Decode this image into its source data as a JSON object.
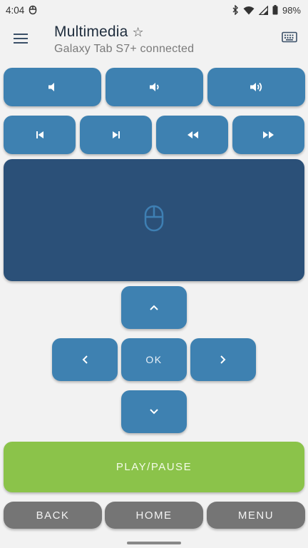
{
  "status_bar": {
    "time": "4:04",
    "battery": "98%",
    "icons": [
      "notification-icon",
      "bluetooth-icon",
      "wifi-icon",
      "signal-icon",
      "battery-icon"
    ]
  },
  "app_bar": {
    "title": "Multimedia",
    "star_icon": "☆",
    "subtitle": "Galaxy Tab S7+ connected",
    "menu_icon": "hamburger-menu-icon",
    "keyboard_icon": "keyboard-icon"
  },
  "volume_row": [
    "volume-mute-icon",
    "volume-down-icon",
    "volume-up-icon"
  ],
  "media_row": [
    "skip-previous-icon",
    "skip-next-icon",
    "rewind-icon",
    "fast-forward-icon"
  ],
  "touchpad": {
    "icon": "mouse-icon"
  },
  "dpad": {
    "ok_label": "OK",
    "icons": [
      "chevron-up-icon",
      "chevron-left-icon",
      "chevron-right-icon",
      "chevron-down-icon"
    ]
  },
  "play_pause": {
    "label": "PLAY/PAUSE"
  },
  "nav": {
    "back": "BACK",
    "home": "HOME",
    "menu": "MENU"
  },
  "colors": {
    "button": "#3e81b1",
    "touchpad": "#2b5078",
    "play": "#8bc34a",
    "nav_button": "#757575",
    "background": "#f2f2f2"
  }
}
